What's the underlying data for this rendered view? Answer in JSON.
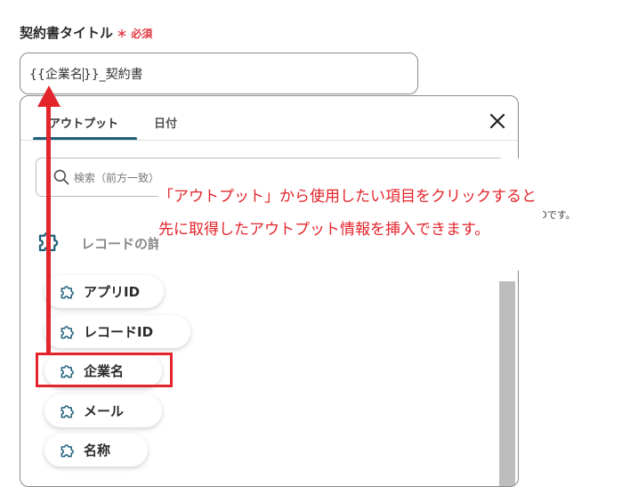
{
  "field": {
    "label": "契約書タイトル",
    "required_mark": "＊ 必須",
    "value_prefix": "{{企業名",
    "value_suffix": "}}_契約書"
  },
  "panel": {
    "tabs": [
      {
        "label": "アウトプット",
        "active": true
      },
      {
        "label": "日付",
        "active": false
      }
    ],
    "search_placeholder": "検索（前方一致）",
    "section_title": "レコードの詳細",
    "items": [
      {
        "label": "アプリID"
      },
      {
        "label": "レコードID"
      },
      {
        "label": "企業名"
      },
      {
        "label": "メール"
      },
      {
        "label": "名称"
      }
    ]
  },
  "annotation": {
    "line1": "「アウトプット」から使用したい項目をクリックすると",
    "line2": "先に取得したアウトプット情報を挿入できます。",
    "hint_tail": "IDです。"
  },
  "colors": {
    "accent": "#e3242b",
    "tab_underline": "#1f5f7a",
    "scrollbar": "#bdbdbd"
  }
}
